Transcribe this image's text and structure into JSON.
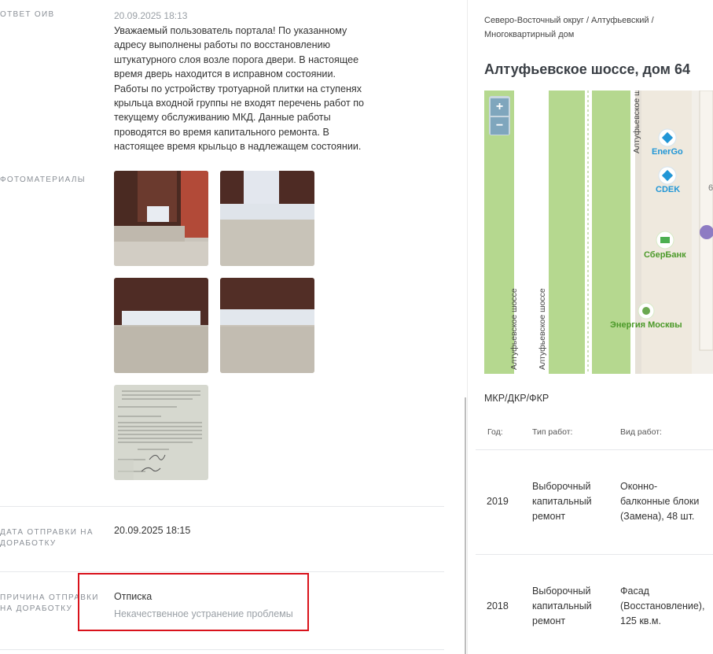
{
  "left": {
    "answer_label": "ОТВЕТ ОИВ",
    "answer_date": "20.09.2025 18:13",
    "answer_text": "Уважаемый пользователь портала! По указанному адресу выполнены работы по восстановлению штукатурного слоя возле порога двери. В настоящее время дверь находится в исправном состоянии. Работы по устройству тротуарной плитки на ступенях крыльца входной группы не входят перечень работ по текущему обслуживанию МКД. Данные работы проводятся во время капитального ремонта. В настоящее время крыльцо в надлежащем состоянии.",
    "photos_label": "ФОТОМАТЕРИАЛЫ",
    "sent_label_1": "ДАТА ОТПРАВКИ НА",
    "sent_label_2": "ДОРАБОТКУ",
    "sent_value": "20.09.2025 18:15",
    "reason_label_1": "ПРИЧИНА ОТПРАВКИ",
    "reason_label_2": "НА ДОРАБОТКУ",
    "reason_value": "Отписка",
    "reason_detail": "Некачественное устранение проблемы"
  },
  "right": {
    "breadcrumb_1": "Северо-Восточный округ / Алтуфьевский /",
    "breadcrumb_2": "Многоквартирный дом",
    "address": "Алтуфьевское шоссе, дом 64",
    "map": {
      "zoom_in": "+",
      "zoom_out": "−",
      "street_1": "Алтуфьевское шоссе",
      "street_2": "Алтуфьевское шоссе",
      "street_3": "Алтуфьевское ш",
      "poi_1": "EnerGo",
      "poi_2": "CDEK",
      "poi_3": "СберБанк",
      "poi_4": "Энергия Москвы",
      "house_num": "6"
    },
    "section_title": "МКР/ДКР/ФКР",
    "table": {
      "headers": [
        "Год:",
        "Тип работ:",
        "Вид работ:"
      ],
      "rows": [
        {
          "year": "2019",
          "type": [
            "Выборочный",
            "капитальный",
            "ремонт"
          ],
          "kind": [
            "Оконно-",
            "балконные блоки",
            "(Замена), 48 шт."
          ]
        },
        {
          "year": "2018",
          "type": [
            "Выборочный",
            "капитальный",
            "ремонт"
          ],
          "kind": [
            "Фасад",
            "(Восстановление),",
            "125 кв.м."
          ]
        }
      ]
    }
  },
  "colors": {
    "highlight": "#d9121b",
    "map_green": "#b5d88f",
    "map_blue": "#2196d6",
    "zoom_btn": "#7fa6bd"
  }
}
